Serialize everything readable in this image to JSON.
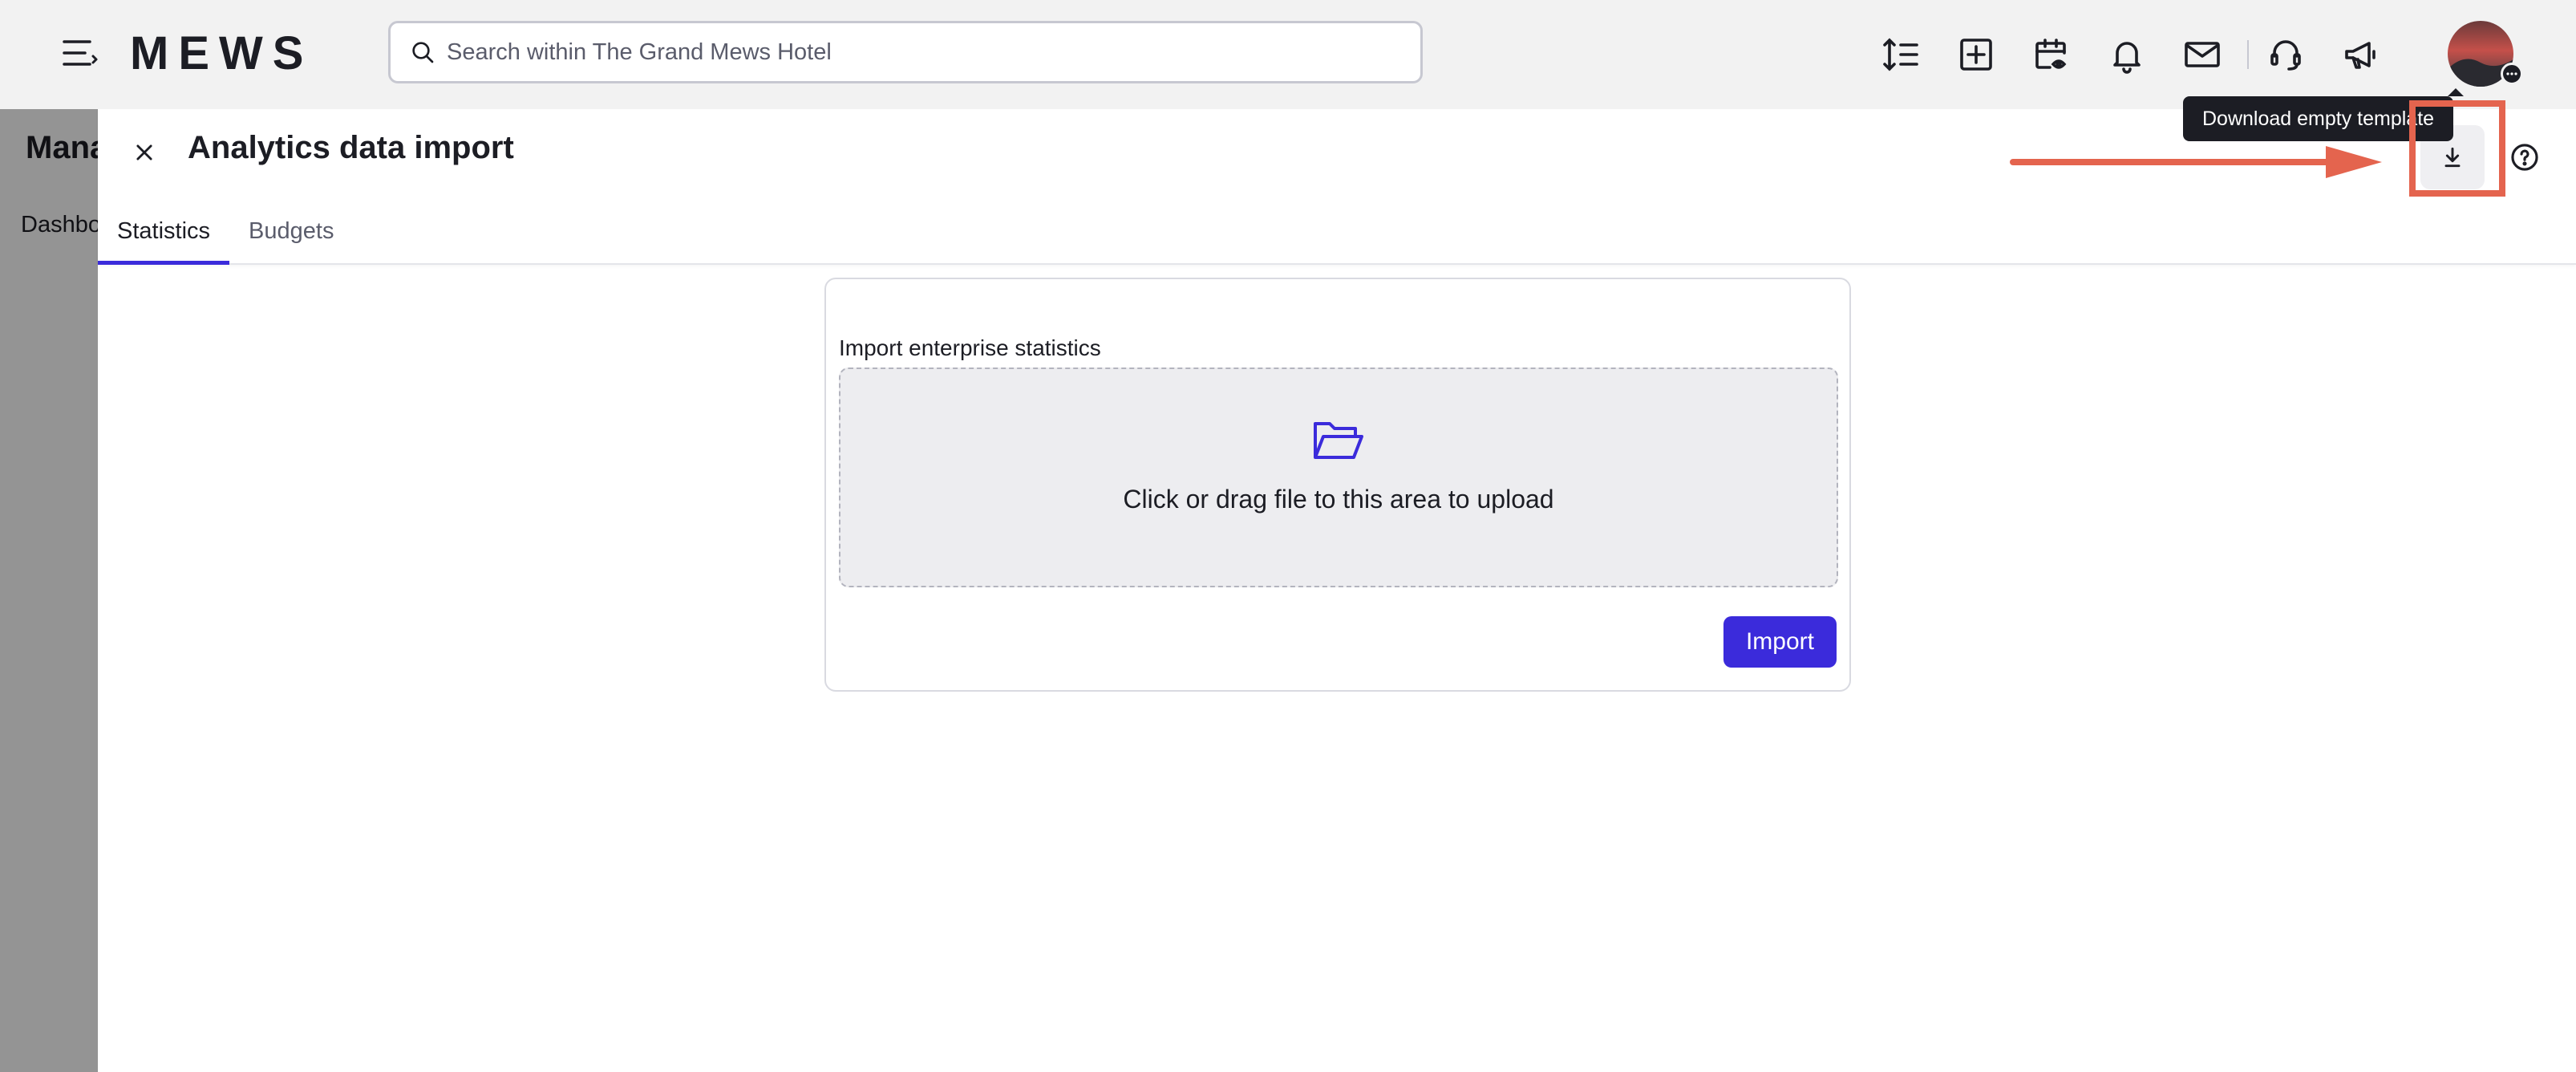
{
  "app": {
    "logo_text": "MEWS",
    "search_placeholder": "Search within The Grand Mews Hotel"
  },
  "topbar": {
    "icons": [
      "text-height-icon",
      "plus-square-icon",
      "calendar-eye-icon",
      "bell-icon",
      "mail-icon",
      "headset-icon",
      "megaphone-icon"
    ]
  },
  "background_page": {
    "title": "Mana",
    "tab": "Dashbo"
  },
  "panel": {
    "title": "Analytics data import",
    "tabs": [
      {
        "label": "Statistics",
        "active": true
      },
      {
        "label": "Budgets",
        "active": false
      }
    ],
    "tooltip": "Download empty template"
  },
  "import_card": {
    "label": "Import enterprise statistics",
    "dropzone_text": "Click or drag file to this area to upload",
    "import_button": "Import"
  },
  "colors": {
    "accent": "#3b2bdb",
    "annotation": "#e4644e",
    "topbar_bg": "#f2f2f2"
  }
}
